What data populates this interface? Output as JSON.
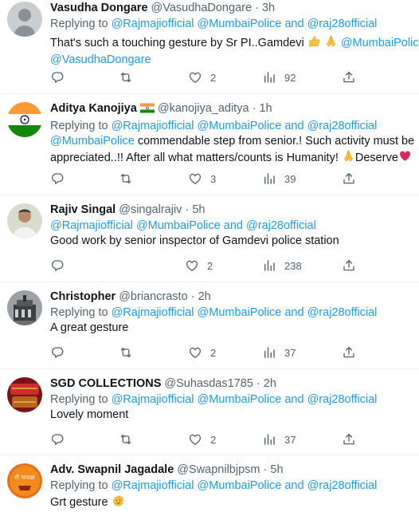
{
  "colors": {
    "link": "#1d9bf0",
    "muted": "#536471",
    "text": "#0f1419",
    "divider": "#eff3f4"
  },
  "icons": {
    "reply": "reply-icon",
    "retweet": "retweet-icon",
    "like": "heart-icon",
    "views": "views-icon",
    "share": "share-icon"
  },
  "tweets": [
    {
      "name": "Vasudha Dongare",
      "handle": "@VasudhaDongare",
      "sep": "·",
      "time": "3h",
      "replying_prefix": "Replying to",
      "mention1": "@Rajmajiofficial",
      "mention2": "@MumbaiPolice",
      "and": "and",
      "mention3": "@raj28official",
      "text1": "That's such a touching gesture by Sr PI..Gamdevi",
      "text_mention1": "@MumbaiPolice",
      "text_mention2": "@VasudhaDongare",
      "likes": "2",
      "views": "92"
    },
    {
      "name": "Aditya Kanojiya",
      "handle": "@kanojiya_aditya",
      "sep": "·",
      "time": "1h",
      "replying_prefix": "Replying to",
      "mention1": "@Rajmajiofficial",
      "mention2": "@MumbaiPolice",
      "and": "and",
      "mention3": "@raj28official",
      "text_mention": "@MumbaiPolice",
      "text1": "commendable step from senior.! Such activity must be",
      "text2": "appreciated..!! After all what matters/counts is Humanity!",
      "text3": "Deserve",
      "likes": "3",
      "views": "39"
    },
    {
      "name": "Rajiv Singal",
      "handle": "@singalrajiv",
      "sep": "·",
      "time": "5h",
      "mention1": "@Rajmajiofficial",
      "mention2": "@MumbaiPolice",
      "and": "and",
      "mention3": "@raj28official",
      "text1": "Good work by senior inspector of Gamdevi police station",
      "likes": "2",
      "views": "238"
    },
    {
      "name": "Christopher",
      "handle": "@briancrasto",
      "sep": "·",
      "time": "2h",
      "replying_prefix": "Replying to",
      "mention1": "@Rajmajiofficial",
      "mention2": "@MumbaiPolice",
      "and": "and",
      "mention3": "@raj28official",
      "text1": "A great gesture",
      "likes": "2",
      "views": "37"
    },
    {
      "name": "SGD COLLECTIONS",
      "handle": "@Suhasdas1785",
      "sep": "·",
      "time": "2h",
      "replying_prefix": "Replying to",
      "mention1": "@Rajmajiofficial",
      "mention2": "@MumbaiPolice",
      "and": "and",
      "mention3": "@raj28official",
      "text1": "Lovely moment",
      "likes": "2",
      "views": "37"
    },
    {
      "name": "Adv. Swapnil Jagadale",
      "handle": "@Swapnilbjpsm",
      "sep": "·",
      "time": "5h",
      "replying_prefix": "Replying to",
      "mention1": "@Rajmajiofficial",
      "mention2": "@MumbaiPolice",
      "and": "and",
      "mention3": "@raj28official",
      "text1": "Grt gesture",
      "avatar_text": "मी मावळा"
    }
  ]
}
